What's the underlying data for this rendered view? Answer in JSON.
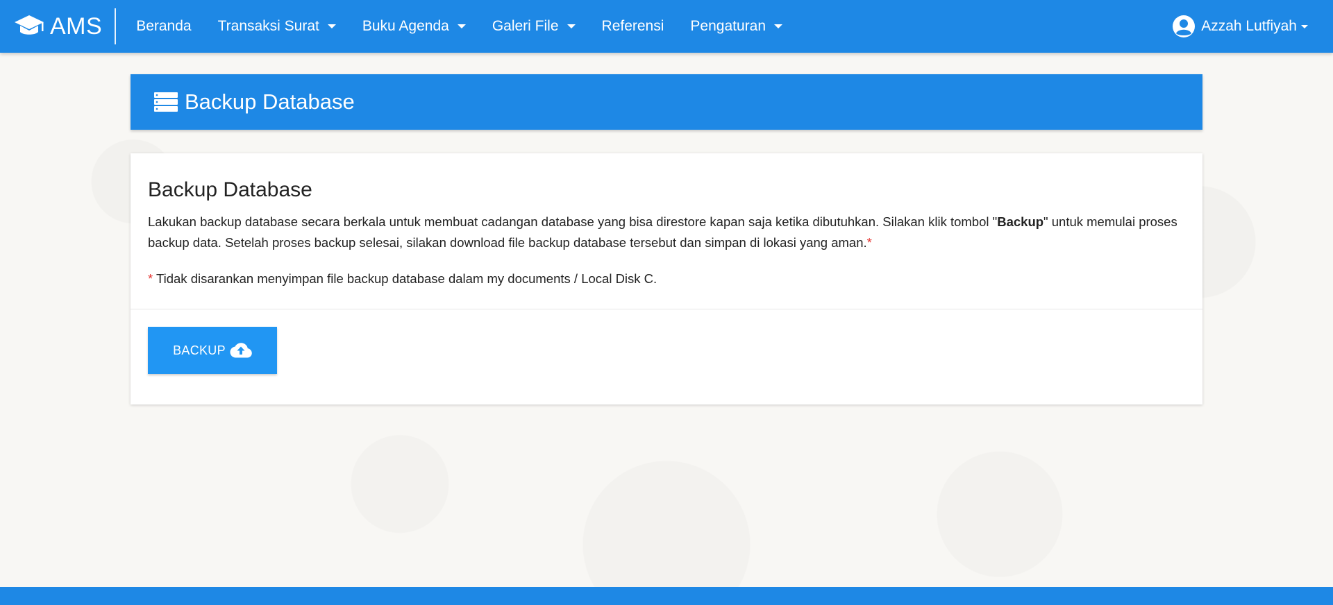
{
  "navbar": {
    "brand": "AMS",
    "items": [
      {
        "label": "Beranda",
        "dropdown": false
      },
      {
        "label": "Transaksi Surat",
        "dropdown": true
      },
      {
        "label": "Buku Agenda",
        "dropdown": true
      },
      {
        "label": "Galeri File",
        "dropdown": true
      },
      {
        "label": "Referensi",
        "dropdown": false
      },
      {
        "label": "Pengaturan",
        "dropdown": true
      }
    ],
    "user_name": "Azzah Lutfiyah"
  },
  "header": {
    "icon": "database-server-icon",
    "title": "Backup Database"
  },
  "card": {
    "title": "Backup Database",
    "text_part1": "Lakukan backup database secara berkala untuk membuat cadangan database yang bisa direstore kapan saja ketika dibutuhkan. Silakan klik tombol \"",
    "text_bold": "Backup",
    "text_part2": "\" untuk memulai proses backup data. Setelah proses backup selesai, silakan download file backup database tersebut dan simpan di lokasi yang aman.",
    "required_mark": "*",
    "note_mark": "*",
    "note_text": " Tidak disarankan menyimpan file backup database dalam my documents / Local Disk C.",
    "button_label": "BACKUP",
    "button_icon": "cloud-upload-icon"
  },
  "colors": {
    "primary": "#1e88e5",
    "button": "#2196f3",
    "required": "#e53935"
  }
}
